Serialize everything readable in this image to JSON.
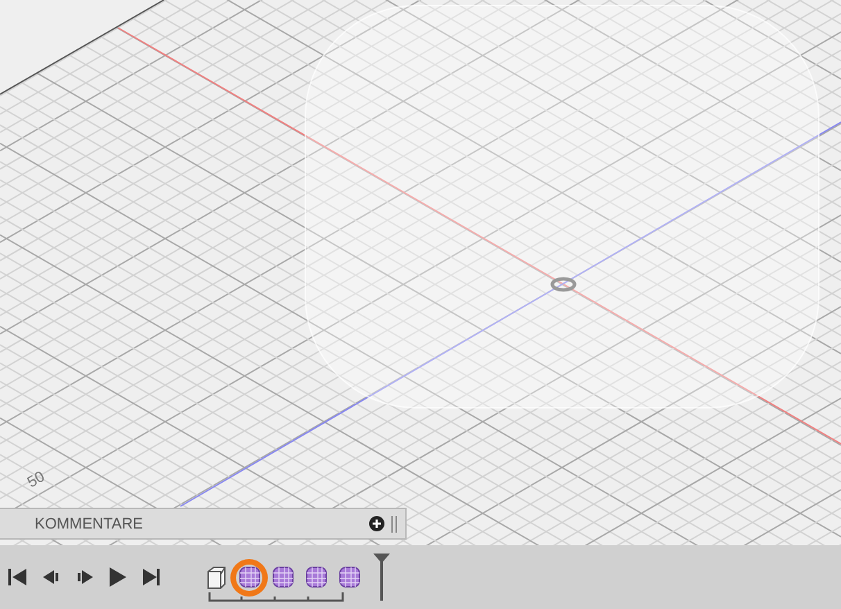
{
  "viewport": {
    "grid_label": "50"
  },
  "comments_panel": {
    "title": "KOMMENTARE"
  },
  "timeline": {
    "features": [
      {
        "kind": "sketch",
        "selected": false
      },
      {
        "kind": "body",
        "selected": true
      },
      {
        "kind": "body",
        "selected": false
      },
      {
        "kind": "body",
        "selected": false
      },
      {
        "kind": "body",
        "selected": false
      }
    ]
  }
}
